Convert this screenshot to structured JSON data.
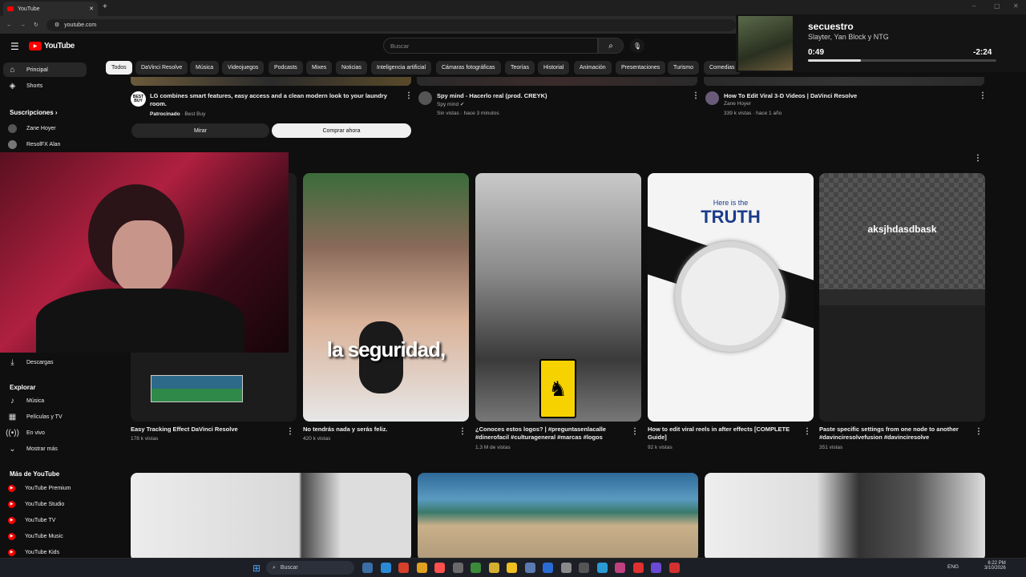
{
  "browser": {
    "tab_title": "YouTube",
    "url": "youtube.com"
  },
  "header": {
    "logo": "YouTube",
    "search_placeholder": "Buscar"
  },
  "chips": [
    "Todos",
    "DaVinci Resolve",
    "Música",
    "Videojuegos",
    "Podcasts",
    "Mixes",
    "Noticias",
    "Inteligencia artificial",
    "Cámaras fotográficas",
    "Teorías",
    "Historial",
    "Animación",
    "Presentaciones",
    "Turismo",
    "Comedias"
  ],
  "sidebar": {
    "main": [
      {
        "label": "Principal"
      },
      {
        "label": "Shorts"
      }
    ],
    "subs_heading": "Suscripciones",
    "subs": [
      {
        "label": "Zane Hoyer"
      },
      {
        "label": "ResolFX Alan"
      }
    ],
    "downloads": "Descargas",
    "explore_heading": "Explorar",
    "explore": [
      {
        "label": "Música"
      },
      {
        "label": "Películas y TV"
      },
      {
        "label": "En vivo"
      },
      {
        "label": "Mostrar más"
      }
    ],
    "more_heading": "Más de YouTube",
    "more": [
      {
        "label": "YouTube Premium"
      },
      {
        "label": "YouTube Studio"
      },
      {
        "label": "YouTube TV"
      },
      {
        "label": "YouTube Music"
      },
      {
        "label": "YouTube Kids"
      }
    ]
  },
  "ad": {
    "title": "LG combines smart features, easy access and a clean modern look to your laundry room.",
    "sponsored": "Patrocinado",
    "advertiser": "Best Buy",
    "watch_btn": "Mirar",
    "buy_btn": "Comprar ahora"
  },
  "top_videos": [
    {
      "title": "Spy mind - Hacerlo real (prod. CREYK)",
      "channel": "Spy mind",
      "meta": "Sin vistas · hace 3 minutos"
    },
    {
      "title": "How To Edit Viral 3-D Videos | DaVinci Resolve",
      "channel": "Zane Hoyer",
      "meta": "339 k vistas · hace 1 año"
    }
  ],
  "shorts": [
    {
      "title": "Easy Tracking Effect DaVinci Resolve",
      "meta": "178 k vistas"
    },
    {
      "title": "No tendrás nada y serás feliz.",
      "meta": "420 k vistas",
      "caption": "la seguridad,"
    },
    {
      "title": "¿Conoces estos logos? | #preguntasenlacalle #dinerofacil #culturageneral #marcas #logos",
      "meta": "1.3 M de vistas"
    },
    {
      "title": "How to edit viral reels in after effects [COMPLETE Guide]",
      "meta": "92 k vistas",
      "thumb_heading1": "Here is the",
      "thumb_heading2": "TRUTH"
    },
    {
      "title": "Paste specific settings from one node to another #davinciresolvefusion #davinciresolve",
      "meta": "351 vistas",
      "thumb_text": "aksjhdasdbask"
    }
  ],
  "media_popup": {
    "title": "secuestro",
    "artist": "Slayter, Yan Block y NTG",
    "elapsed": "0:49",
    "remaining": "-2:24",
    "progress": 0.28
  },
  "taskbar": {
    "search": "Buscar",
    "lang": "ENG",
    "time": "6:22 PM",
    "date": "3/10/2026"
  }
}
